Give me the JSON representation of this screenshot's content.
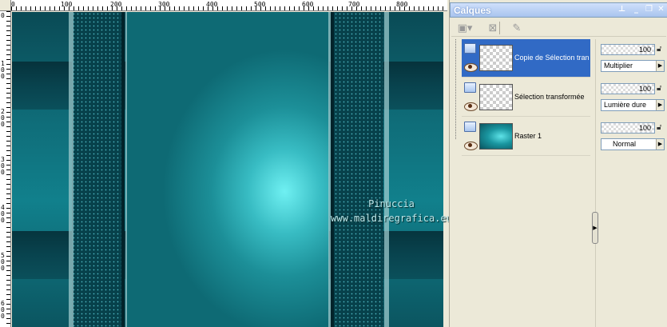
{
  "ruler": {
    "top_labels": [
      "0",
      "100",
      "200",
      "300",
      "400",
      "500",
      "600",
      "700",
      "800"
    ],
    "left_labels": [
      "0",
      "1 0 0",
      "2 0 0",
      "3 0 0",
      "4 0 0",
      "5 0 0",
      "6 0 0"
    ]
  },
  "watermark": {
    "line1": "Pinuccia",
    "line2": "www.maldiregrafica.eu"
  },
  "palette": {
    "title": "Calques",
    "title_buttons": [
      "pin-icon",
      "minimize-icon",
      "restore-icon",
      "close-icon"
    ],
    "toolbar_icons": [
      "new-layer-icon",
      "delete-layer-icon",
      "properties-icon"
    ]
  },
  "layers": [
    {
      "name": "Copie de Sélection tran",
      "selected": true,
      "thumb": "checker-frame",
      "opacity": "100",
      "blend": "Multiplier"
    },
    {
      "name": "Sélection transformée",
      "selected": false,
      "thumb": "checker-frame",
      "opacity": "100",
      "blend": "Lumière dure"
    },
    {
      "name": "Raster 1",
      "selected": false,
      "thumb": "raster",
      "opacity": "100",
      "blend": "Normal"
    }
  ],
  "colors": {
    "selection": "#316ac5",
    "title_bar": "#a9c4ee",
    "teal_light": "#6ff0f2",
    "teal_dark": "#052f38"
  }
}
